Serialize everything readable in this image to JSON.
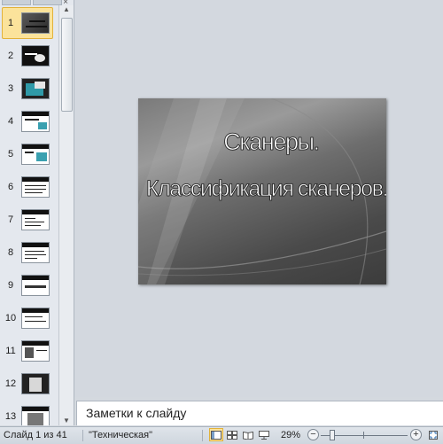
{
  "thumbnails": [
    {
      "number": "1",
      "selected": true
    },
    {
      "number": "2"
    },
    {
      "number": "3"
    },
    {
      "number": "4"
    },
    {
      "number": "5"
    },
    {
      "number": "6"
    },
    {
      "number": "7"
    },
    {
      "number": "8"
    },
    {
      "number": "9"
    },
    {
      "number": "10"
    },
    {
      "number": "11"
    },
    {
      "number": "12"
    },
    {
      "number": "13"
    }
  ],
  "panel": {
    "close_glyph": "×"
  },
  "slide": {
    "title_line1": "Сканеры.",
    "title_line2": "Классификация сканеров."
  },
  "notes": {
    "placeholder": "Заметки к слайду"
  },
  "status": {
    "slide_info": "Слайд 1 из 41",
    "theme": "\"Техническая\"",
    "zoom": "29%",
    "zoom_minus": "−",
    "zoom_plus": "+"
  },
  "colors": {
    "selection": "#fbe39b",
    "selection_border": "#e2b23a"
  }
}
